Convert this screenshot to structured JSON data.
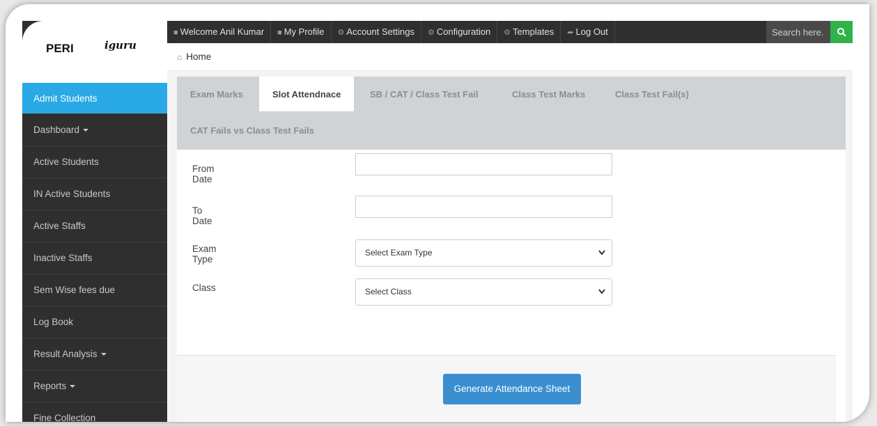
{
  "logo": {
    "brand": "PERI",
    "product": "iguru"
  },
  "sidebar": {
    "items": [
      {
        "label": "Admit Students"
      },
      {
        "label": "Dashboard"
      },
      {
        "label": "Active Students"
      },
      {
        "label": "IN Active Students"
      },
      {
        "label": "Active Staffs"
      },
      {
        "label": "Inactive Staffs"
      },
      {
        "label": "Sem Wise fees due"
      },
      {
        "label": "Log Book"
      },
      {
        "label": "Result Analysis"
      },
      {
        "label": "Reports"
      },
      {
        "label": "Fine Collection"
      }
    ]
  },
  "topnav": {
    "welcome": "Welcome Anil Kumar",
    "profile": "My Profile",
    "account": "Account Settings",
    "configuration": "Configuration",
    "templates": "Templates",
    "logout": "Log Out",
    "search_placeholder": "Search here."
  },
  "breadcrumb": {
    "home": "Home"
  },
  "tabs": [
    {
      "label": "Exam Marks"
    },
    {
      "label": "Slot Attendnace"
    },
    {
      "label": "SB / CAT / Class Test Fail"
    },
    {
      "label": "Class Test Marks"
    },
    {
      "label": "Class Test Fail(s)"
    },
    {
      "label": "CAT Fails vs Class Test Fails"
    }
  ],
  "form": {
    "from_date_label": "From Date",
    "from_date_value": "",
    "to_date_label": "To Date",
    "to_date_value": "",
    "exam_type_label": "Exam Type",
    "exam_type_selected": "Select Exam Type",
    "class_label": "Class",
    "class_selected": "Select Class",
    "generate_button": "Generate Attendance Sheet"
  },
  "colors": {
    "sidebar_bg": "#2f2f2f",
    "active_item": "#29a9e6",
    "search_button": "#2fb24a",
    "primary_button": "#3a8fd0",
    "tab_bar": "#d0d3d6"
  }
}
